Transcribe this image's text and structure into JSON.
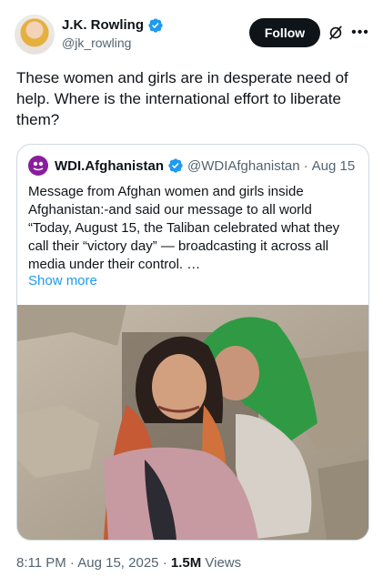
{
  "author": {
    "name": "J.K. Rowling",
    "handle": "@jk_rowling",
    "verified_color": "#1d9bf0"
  },
  "actions": {
    "follow_label": "Follow",
    "grok_icon": "grok-icon",
    "more_icon": "more-icon"
  },
  "tweet": {
    "text": "These women and girls are in desperate need of help. Where is the international effort to liberate them?"
  },
  "quoted": {
    "name": "WDI.Afghanistan",
    "handle": "@WDIAfghanistan",
    "separator": "·",
    "date": "Aug 15",
    "text": "Message from Afghan women and girls inside Afghanistan:-and said our message to all world “Today, August 15, the Taliban celebrated what they call their “victory day” — broadcasting it across all media under their control.  …",
    "show_more": "Show more",
    "avatar_color": "#8a1c9e"
  },
  "footer": {
    "time": "8:11 PM",
    "sep1": "·",
    "date": "Aug 15, 2025",
    "sep2": "·",
    "views_count": "1.5M",
    "views_label": "Views"
  }
}
